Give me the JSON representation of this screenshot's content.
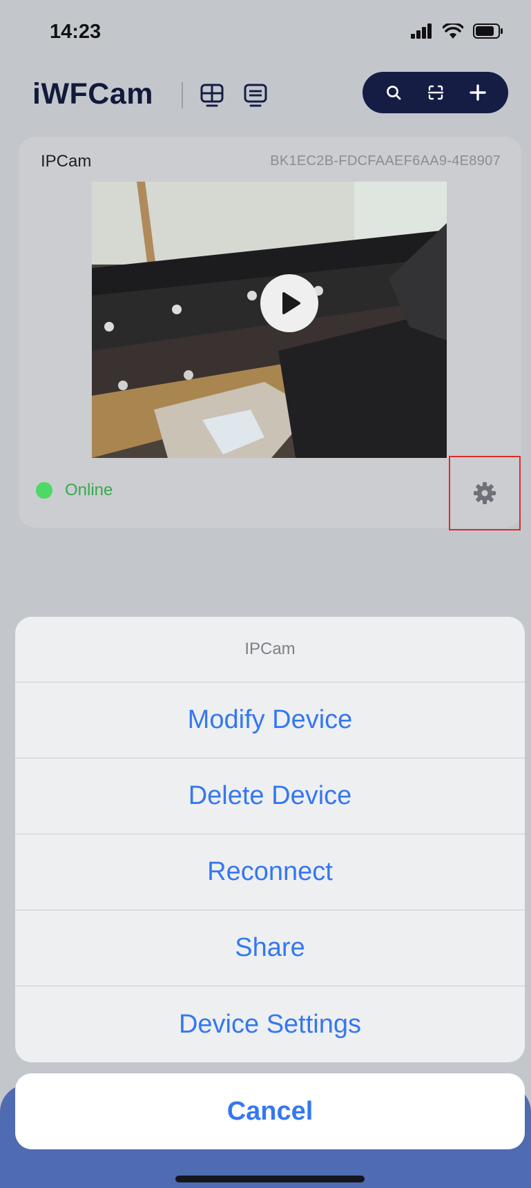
{
  "status_bar": {
    "time": "14:23",
    "icons": [
      "signal-icon",
      "wifi-icon",
      "battery-icon"
    ]
  },
  "header": {
    "app_title": "iWFCam",
    "view_icons": [
      "grid-view-icon",
      "list-view-icon"
    ],
    "actions": [
      "search-icon",
      "scan-icon",
      "add-icon"
    ]
  },
  "device": {
    "name": "IPCam",
    "id": "BK1EC2B-FDCFAAEF6AA9-4E8907",
    "status": "Online",
    "status_color": "#4cd964",
    "settings_icon": "gear-icon",
    "play_icon": "play-icon"
  },
  "action_sheet": {
    "title": "IPCam",
    "options": [
      "Modify Device",
      "Delete Device",
      "Reconnect",
      "Share",
      "Device Settings"
    ],
    "cancel": "Cancel",
    "accent_color": "#3478f0"
  }
}
